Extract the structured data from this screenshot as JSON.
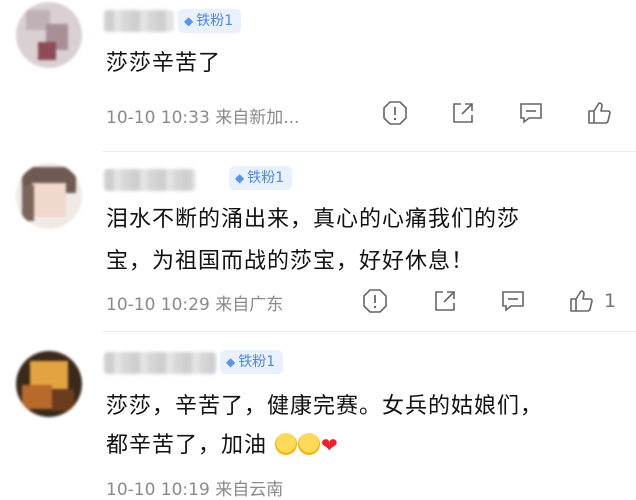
{
  "comments": [
    {
      "badge": "铁粉1",
      "text": "莎莎辛苦了",
      "meta": "10-10 10:33  来自新加...",
      "like_count": ""
    },
    {
      "badge": "铁粉1",
      "text_line1": "泪水不断的涌出来，真心的心痛我们的莎",
      "text_line2": "宝，为祖国而战的莎宝，好好休息！",
      "meta": "10-10 10:29  来自广东",
      "like_count": "1"
    },
    {
      "badge": "铁粉1",
      "text_line1": "莎莎，辛苦了，健康完赛。女兵的姑娘们，",
      "text_line2": "都辛苦了，加油",
      "meta": "10-10 10:19  来自云南"
    }
  ],
  "icons": [
    "report-icon",
    "share-icon",
    "comment-icon",
    "like-icon"
  ],
  "colors": {
    "badge_text": "#4d86e6",
    "badge_bg": "#e8f1fd",
    "meta": "#8a8a8a",
    "heart": "#e8232a"
  }
}
